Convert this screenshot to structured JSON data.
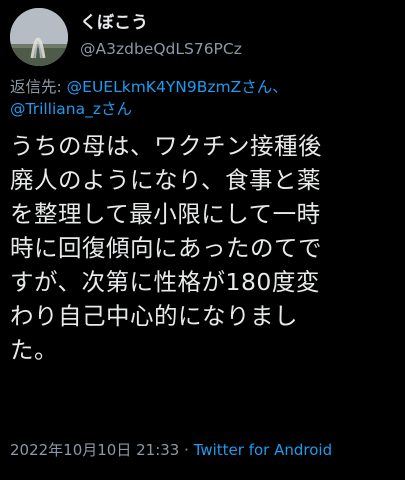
{
  "user": {
    "display_name": "くぼこう",
    "handle": "@A3zdbeQdLS76PCz"
  },
  "reply": {
    "prefix": "返信先: ",
    "mention1": "@EUELkmK4YN9BzmZさん、",
    "mention2": "@Trilliana_zさん"
  },
  "tweet_lines": [
    "うちの母は、ワクチン接種後",
    "廃人のようになり、食事と薬",
    "を整理して最小限にして一時",
    "時に回復傾向にあったのてで",
    "すが、次第に性格が180度変",
    "わり自己中心的になりまし",
    "た。"
  ],
  "meta": {
    "timestamp": "2022年10月10日 21:33",
    "separator": " · ",
    "source": "Twitter for Android"
  },
  "colors": {
    "background": "#000000",
    "text": "#e7e9ea",
    "secondary": "#8b98a5",
    "link": "#1d9bf0"
  }
}
